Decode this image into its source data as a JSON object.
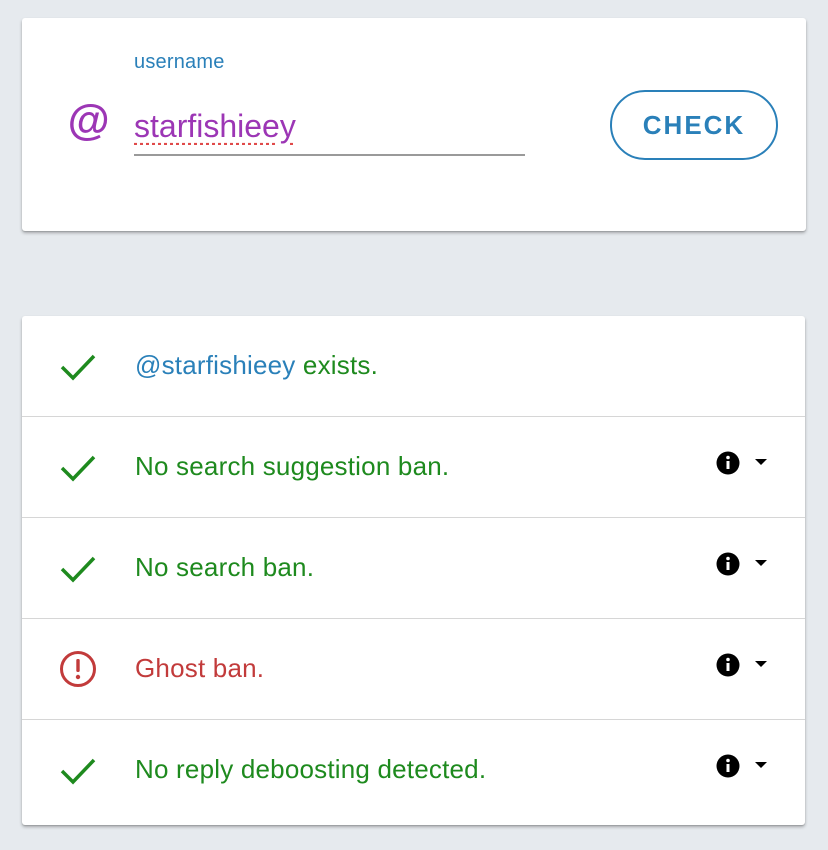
{
  "search": {
    "at_symbol": "@",
    "label": "username",
    "value": "starfishieey",
    "button_label": "CHECK"
  },
  "results": {
    "exists": {
      "handle": "@starfishieey",
      "suffix": " exists.",
      "status": "ok",
      "icon": "check-icon"
    },
    "items": [
      {
        "label": "No search suggestion ban.",
        "status": "ok",
        "icon": "check-icon"
      },
      {
        "label": "No search ban.",
        "status": "ok",
        "icon": "check-icon"
      },
      {
        "label": "Ghost ban.",
        "status": "error",
        "icon": "error-circle-icon"
      },
      {
        "label": "No reply deboosting detected.",
        "status": "ok",
        "icon": "check-icon"
      }
    ]
  },
  "colors": {
    "background": "#e6eaee",
    "accent_blue": "#2a80b9",
    "accent_purple": "#9c36b5",
    "success_green": "#1e8a1e",
    "error_red": "#c23b3b"
  }
}
